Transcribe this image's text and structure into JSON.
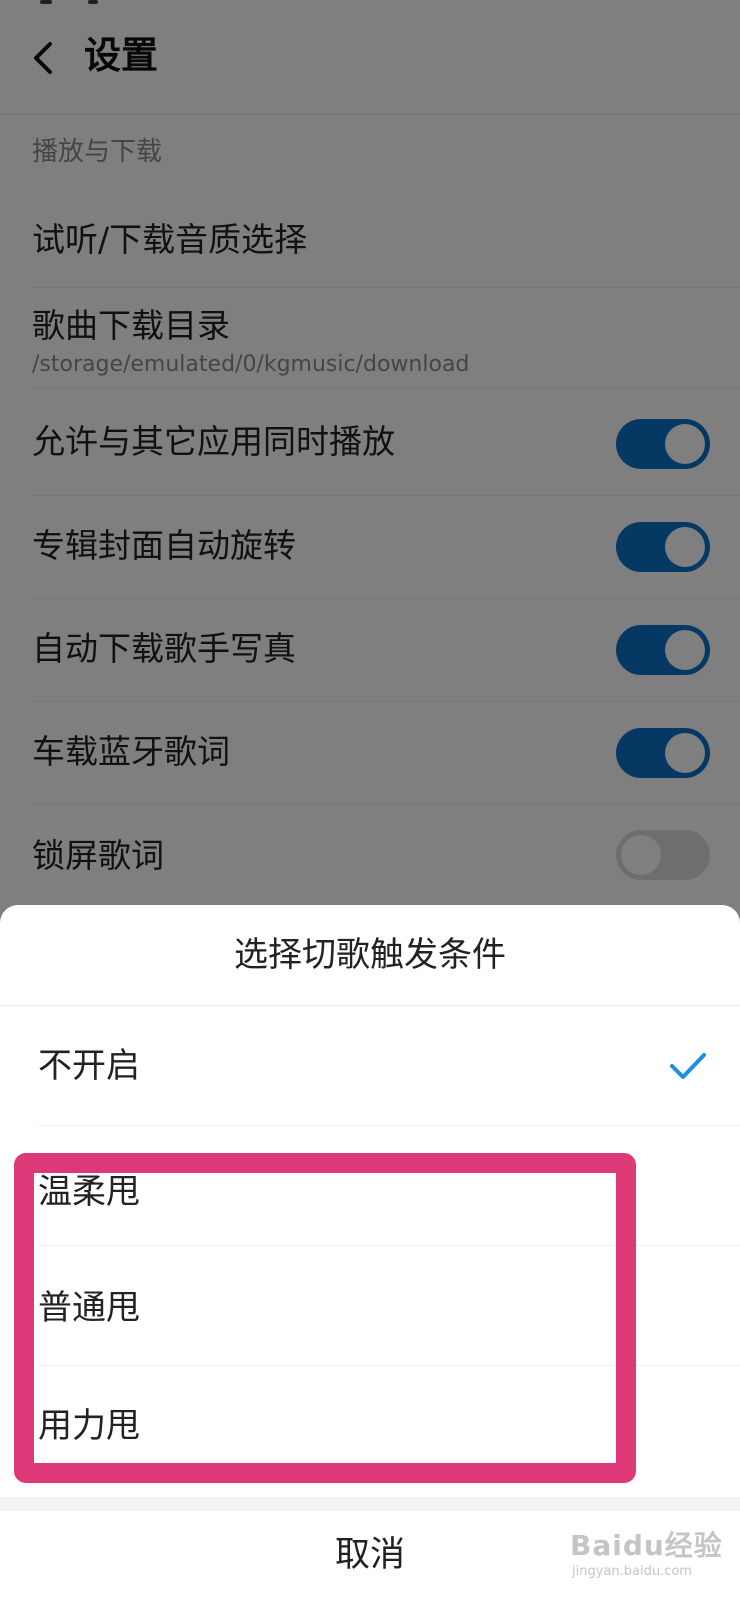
{
  "header": {
    "title": "设置"
  },
  "section": {
    "title": "播放与下载"
  },
  "settings": {
    "quality": {
      "label": "试听/下载音质选择"
    },
    "download_dir": {
      "label": "歌曲下载目录",
      "path": "/storage/emulated/0/kgmusic/download"
    },
    "concurrent_play": {
      "label": "允许与其它应用同时播放",
      "enabled": true
    },
    "cover_rotate": {
      "label": "专辑封面自动旋转",
      "enabled": true
    },
    "singer_photo": {
      "label": "自动下载歌手写真",
      "enabled": true
    },
    "car_bluetooth": {
      "label": "车载蓝牙歌词",
      "enabled": true
    },
    "lockscreen_lyrics": {
      "label": "锁屏歌词",
      "enabled": false
    }
  },
  "sheet": {
    "title": "选择切歌触发条件",
    "options": [
      {
        "label": "不开启",
        "selected": true
      },
      {
        "label": "温柔甩",
        "selected": false
      },
      {
        "label": "普通甩",
        "selected": false
      },
      {
        "label": "用力甩",
        "selected": false
      }
    ],
    "cancel_label": "取消"
  },
  "watermark": {
    "main": "Baidu经验",
    "sub": "jingyan.baidu.com"
  },
  "colors": {
    "toggle_on": "#0a73c9",
    "check": "#1a8fe3",
    "highlight": "#dd3877"
  },
  "icons": {
    "back": "chevron-left-icon",
    "check": "checkmark-icon"
  }
}
